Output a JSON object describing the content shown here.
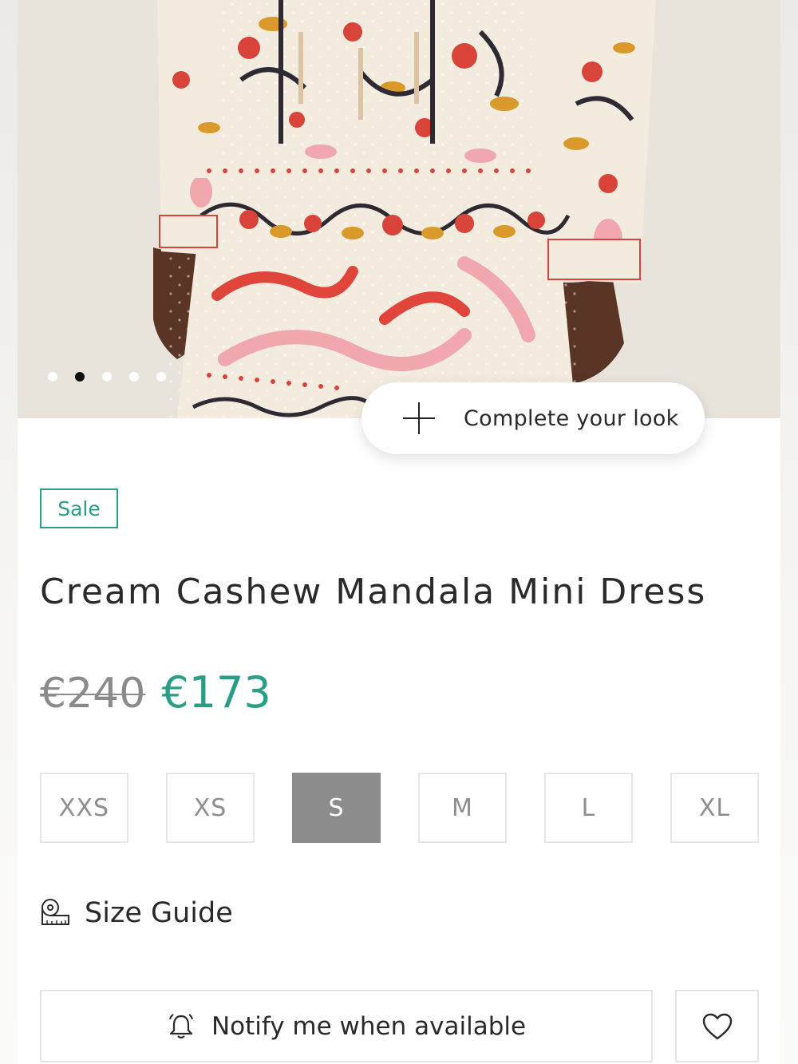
{
  "gallery": {
    "image_alt": "Model wearing printed mini dress",
    "dot_count": 5,
    "active_dot": 2
  },
  "complete_look": {
    "label": "Complete your look",
    "icon": "plus-icon"
  },
  "product": {
    "badge": "Sale",
    "title": "Cream Cashew Mandala Mini Dress",
    "original_price": "€240",
    "sale_price": "€173"
  },
  "sizes": [
    {
      "label": "XXS",
      "selected": false
    },
    {
      "label": "XS",
      "selected": false
    },
    {
      "label": "S",
      "selected": true
    },
    {
      "label": "M",
      "selected": false
    },
    {
      "label": "L",
      "selected": false
    },
    {
      "label": "XL",
      "selected": false
    }
  ],
  "size_guide": {
    "label": "Size Guide",
    "icon": "measuring-tape-icon"
  },
  "actions": {
    "notify_label": "Notify me when available",
    "notify_icon": "bell-icon",
    "wishlist_icon": "heart-icon"
  },
  "colors": {
    "accent": "#2a9d86",
    "selected_size_bg": "#8c8c8c",
    "strike_price": "#8a8a8a"
  }
}
